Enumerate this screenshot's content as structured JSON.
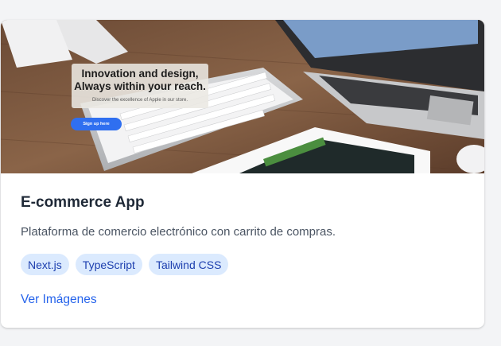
{
  "project": {
    "image": {
      "headline_line1": "Innovation and design,",
      "headline_line2": "Always within your reach.",
      "subtext": "Discover the excellence of Apple in our store.",
      "cta_label": "Sign up here"
    },
    "title": "E-commerce App",
    "description": "Plataforma de comercio electrónico con carrito de compras.",
    "tags": [
      "Next.js",
      "TypeScript",
      "Tailwind CSS"
    ],
    "link_label": "Ver Imágenes"
  },
  "colors": {
    "accent": "#2563eb",
    "tag_bg": "#dbeafe",
    "tag_text": "#1e40af",
    "title": "#1f2937"
  }
}
